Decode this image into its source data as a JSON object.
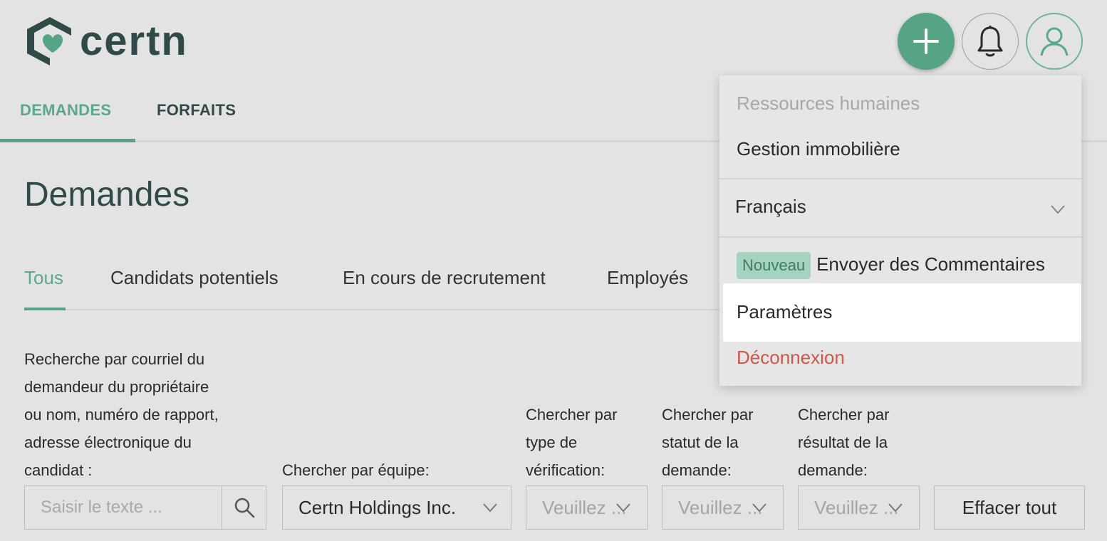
{
  "brand": {
    "name": "certn",
    "primary_color": "#56a484",
    "dark_color": "#2f4a48"
  },
  "header": {
    "add_icon": "plus-icon",
    "bell_icon": "bell-icon",
    "user_icon": "user-icon"
  },
  "top_tabs": [
    {
      "label": "DEMANDES",
      "active": true
    },
    {
      "label": "FORFAITS",
      "active": false
    }
  ],
  "page_title": "Demandes",
  "sub_tabs": [
    {
      "label": "Tous",
      "active": true
    },
    {
      "label": "Candidats potentiels",
      "active": false
    },
    {
      "label": "En cours de recrutement",
      "active": false
    },
    {
      "label": "Employés",
      "active": false
    }
  ],
  "filters": {
    "search": {
      "label_lines": [
        "Recherche par courriel du",
        "demandeur du propriétaire",
        "ou nom, numéro de rapport,",
        "adresse électronique du",
        "candidat :"
      ],
      "placeholder": "Saisir le texte ..."
    },
    "team": {
      "label": "Chercher par équipe:",
      "value": "Certn Holdings Inc."
    },
    "verification_type": {
      "label_lines": [
        "Chercher par",
        "type de",
        "vérification:"
      ],
      "placeholder": "Veuillez ..."
    },
    "request_status": {
      "label_lines": [
        "Chercher par",
        "statut de la",
        "demande:"
      ],
      "placeholder": "Veuillez ..."
    },
    "request_result": {
      "label_lines": [
        "Chercher par",
        "résultat de la",
        "demande:"
      ],
      "placeholder": "Veuillez ..."
    },
    "clear_label": "Effacer tout"
  },
  "menu": {
    "section_disabled": "Ressources humaines",
    "section_option": "Gestion immobilière",
    "language": "Français",
    "feedback_badge": "Nouveau",
    "feedback_label": "Envoyer des Commentaires",
    "settings_label": "Paramètres",
    "logout_label": "Déconnexion"
  }
}
